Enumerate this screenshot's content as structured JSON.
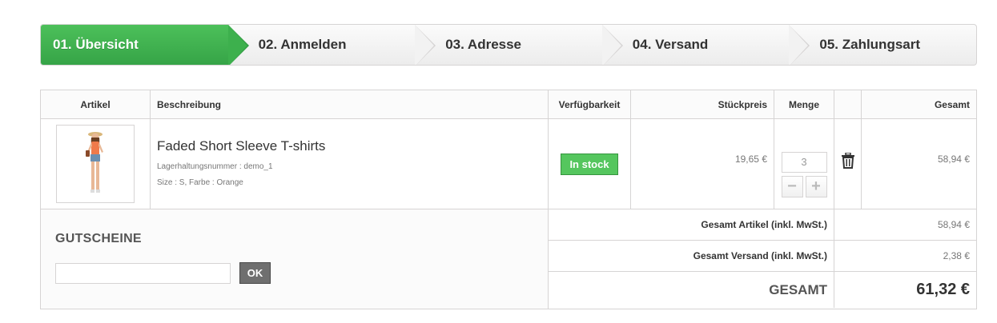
{
  "steps": [
    {
      "label": "01. Übersicht",
      "active": true
    },
    {
      "label": "02. Anmelden",
      "active": false
    },
    {
      "label": "03. Adresse",
      "active": false
    },
    {
      "label": "04. Versand",
      "active": false
    },
    {
      "label": "05. Zahlungsart",
      "active": false
    }
  ],
  "table": {
    "headers": {
      "article": "Artikel",
      "description": "Beschreibung",
      "availability": "Verfügbarkeit",
      "unit_price": "Stückpreis",
      "quantity": "Menge",
      "total": "Gesamt"
    },
    "product": {
      "name": "Faded Short Sleeve T-shirts",
      "sku": "Lagerhaltungsnummer : demo_1",
      "attributes": "Size : S, Farbe : Orange",
      "availability": "In stock",
      "unit_price": "19,65 €",
      "quantity": "3",
      "total": "58,94 €",
      "image_icon": "product-image-woman",
      "delete_icon": "trash-icon"
    }
  },
  "voucher": {
    "title": "GUTSCHEINE",
    "input_value": "",
    "button_label": "OK"
  },
  "totals": {
    "articles_label": "Gesamt Artikel (inkl. MwSt.)",
    "articles_value": "58,94 €",
    "shipping_label": "Gesamt Versand (inkl. MwSt.)",
    "shipping_value": "2,38 €",
    "grand_label": "GESAMT",
    "grand_value": "61,32 €"
  },
  "colors": {
    "active_step": "#3db04d",
    "in_stock": "#55c65e",
    "button_dark": "#6f6f6f"
  }
}
